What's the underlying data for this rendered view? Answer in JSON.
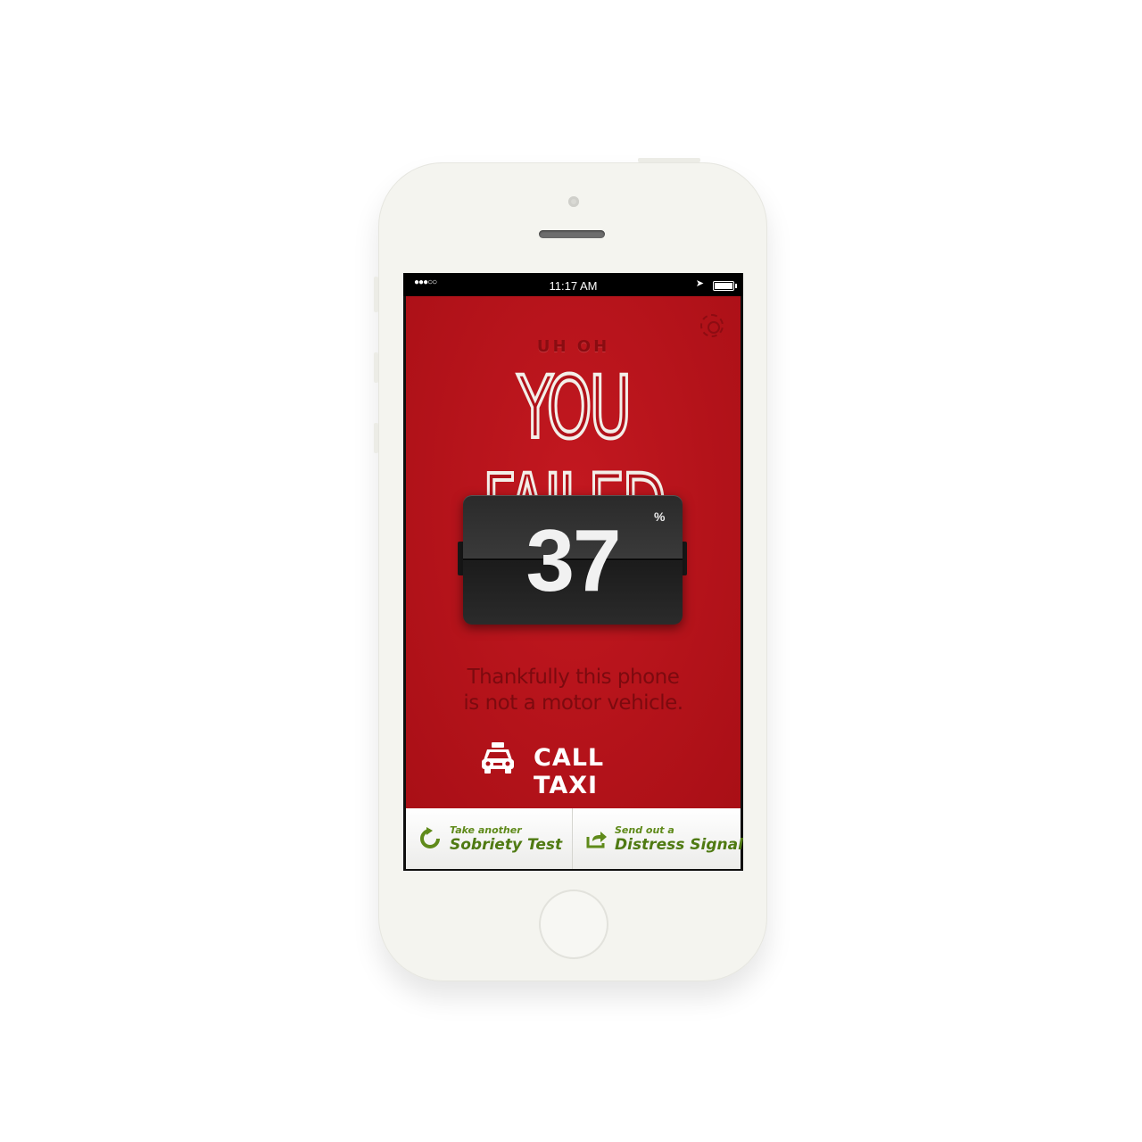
{
  "status_bar": {
    "signal": "●●●○○",
    "time": "11:17 AM"
  },
  "header": {
    "kicker": "UH OH",
    "headline": "YOU FAILED"
  },
  "score": {
    "value": "37",
    "unit": "%"
  },
  "message": "Thankfully this phone\nis not a motor vehicle.",
  "taxi_button": {
    "label": "CALL TAXI",
    "icon": "taxi-icon"
  },
  "bottom_bar": {
    "retest": {
      "small": "Take another",
      "big": "Sobriety Test",
      "icon": "refresh-icon"
    },
    "distress": {
      "small": "Send out a",
      "big": "Distress Signal",
      "icon": "share-icon"
    }
  },
  "colors": {
    "app_background": "#b0121a",
    "accent_green": "#5f8a1a",
    "counter_dark": "#2a2a2a"
  }
}
